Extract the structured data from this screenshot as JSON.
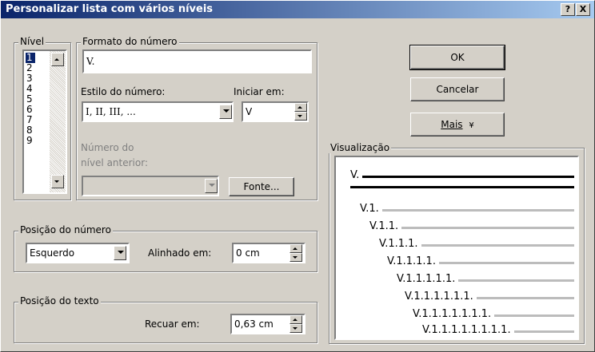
{
  "window": {
    "title": "Personalizar lista com vários níveis",
    "help_label": "?",
    "close_label": "X"
  },
  "level": {
    "legend": "Nível",
    "items": [
      "1",
      "2",
      "3",
      "4",
      "5",
      "6",
      "7",
      "8",
      "9"
    ],
    "selected": "1"
  },
  "number_format": {
    "legend": "Formato do número",
    "format_value": "V.",
    "style_label": "Estilo do número:",
    "style_value": "I, II, III, ...",
    "start_label": "Iniciar em:",
    "start_value": "V",
    "prev_level_label_1": "Número do",
    "prev_level_label_2": "nível anterior:",
    "font_button": "Fonte..."
  },
  "number_position": {
    "legend": "Posição do número",
    "alignment_value": "Esquerdo",
    "aligned_at_label": "Alinhado em:",
    "aligned_at_value": "0 cm"
  },
  "text_position": {
    "legend": "Posição do texto",
    "indent_label": "Recuar em:",
    "indent_value": "0,63 cm"
  },
  "buttons": {
    "ok": "OK",
    "cancel": "Cancelar",
    "more": "Mais",
    "more_arrow": "¥"
  },
  "preview": {
    "legend": "Visualização",
    "rows": [
      "V.",
      "V.1.",
      "V.1.1.",
      "V.1.1.1.",
      "V.1.1.1.1.",
      "V.1.1.1.1.1.",
      "V.1.1.1.1.1.1.",
      "V.1.1.1.1.1.1.1.",
      "V.1.1.1.1.1.1.1.1."
    ]
  }
}
